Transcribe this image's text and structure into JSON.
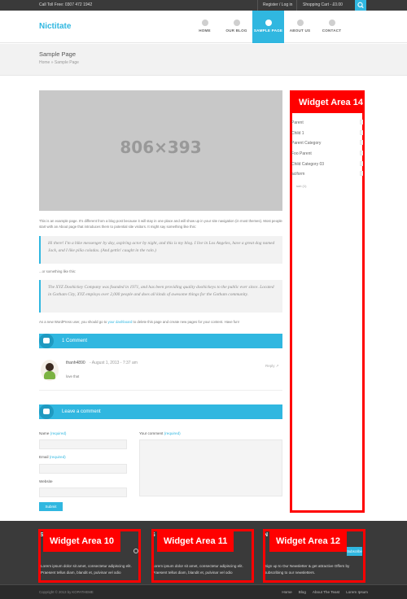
{
  "topbar": {
    "phone": "Call Toll Free: 0307 472 1942",
    "register": "Register / Log in",
    "cart": "Shopping Cart - £0.00"
  },
  "header": {
    "logo": "Nictitate",
    "nav": [
      {
        "label": "HOME",
        "active": false
      },
      {
        "label": "OUR BLOG",
        "active": false
      },
      {
        "label": "SAMPLE PAGE",
        "active": true
      },
      {
        "label": "ABOUT US",
        "active": false
      },
      {
        "label": "CONTACT",
        "active": false
      }
    ]
  },
  "page": {
    "title": "Sample Page",
    "breadcrumb": "Home » Sample Page",
    "placeholder": "806×393",
    "intro": "This is an example page. It's different from a blog post because it will stay in one place and will show up in your site navigation (in most themes). Most people start with an About page that introduces them to potential site visitors. It might say something like this:",
    "quote1": "Hi there! I'm a bike messenger by day, aspiring actor by night, and this is my blog. I live in Los Angeles, have a great dog named Jack, and I like piña coladas. (And gettin' caught in the rain.)",
    "or_text": "...or something like this:",
    "quote2": "The XYZ Doohickey Company was founded in 1971, and has been providing quality doohickeys to the public ever since. Located in Gotham City, XYZ employs over 2,000 people and does all kinds of awesome things for the Gotham community.",
    "admin_pre": "As a new WordPress user, you should go to ",
    "admin_link": "your dashboard",
    "admin_post": " to delete this page and create new pages for your content. Have fun!"
  },
  "comments": {
    "heading": "1 Comment",
    "author": "thanh4890",
    "date": "- August 1, 2013 - 7:37 am",
    "body": "love that",
    "reply": "Reply"
  },
  "form": {
    "heading": "Leave a comment",
    "name_label": "Name",
    "email_label": "Email",
    "website_label": "Website",
    "comment_label": "Your comment",
    "required": "(required)",
    "submit": "Submit"
  },
  "sidebar": {
    "widget_label": "Widget Area 14",
    "items": [
      "Parent",
      "Child 1",
      "Parent Category",
      "Foo Parent",
      "Child Category 03",
      "aciform"
    ],
    "sub": "sub (1)"
  },
  "footer": {
    "widgets": [
      {
        "label": "Widget Area 10",
        "heading_letter": "S",
        "text": "Lorem ipsum dolor sit amet, consectetur adipiscing elit. Praesent tellus diam, blandit et, pulvinar vel odio"
      },
      {
        "label": "Widget Area 11",
        "heading_letter": "S",
        "text": "Lorem ipsum dolor sit amet, consectetur adipiscing elit. Praesent tellus diam, blandit et, pulvinar vel odio"
      },
      {
        "label": "Widget Area 12",
        "heading_letter": "N",
        "text": "Sign up to Our Newsletter & get attractive Offers by subscribing to our newsletters."
      }
    ],
    "subscribe": "Subscribe",
    "copyright": "Copyright © 2013 by KOPATHEME",
    "nav": [
      "Home",
      "Blog",
      "About The Teast",
      "Lorem Ipsum"
    ]
  },
  "colors": {
    "accent": "#30b7e0",
    "widget_outline": "#ff0000",
    "footer_bg": "#3a3a3a"
  }
}
